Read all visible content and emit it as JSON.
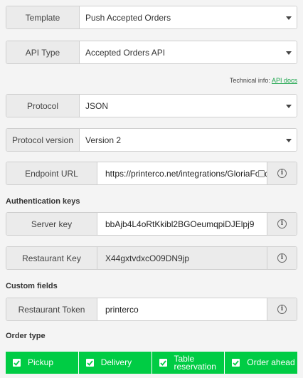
{
  "template": {
    "label": "Template",
    "value": "Push Accepted Orders"
  },
  "api_type": {
    "label": "API Type",
    "value": "Accepted Orders API"
  },
  "technical_info": {
    "prefix": "Technical info:",
    "link": "API docs"
  },
  "protocol": {
    "label": "Protocol",
    "value": "JSON"
  },
  "protocol_version": {
    "label": "Protocol version",
    "value": "Version 2"
  },
  "endpoint": {
    "label": "Endpoint URL",
    "value": "https://printerco.net/integrations/GloriaFood"
  },
  "auth_section": "Authentication keys",
  "server_key": {
    "label": "Server key",
    "value": "bbAjb4L4oRtKkibl2BGOeumqpiDJElpj9"
  },
  "restaurant_key": {
    "label": "Restaurant Key",
    "value": "X44gxtvdxcO09DN9jp"
  },
  "custom_section": "Custom fields",
  "restaurant_token": {
    "label": "Restaurant Token",
    "value": "printerco"
  },
  "order_section": "Order type",
  "order_types": [
    {
      "label": "Pickup",
      "checked": true
    },
    {
      "label": "Delivery",
      "checked": true
    },
    {
      "label": "Table reservation",
      "checked": true
    },
    {
      "label": "Order ahead",
      "checked": true
    }
  ],
  "accent_color": "#00cc44",
  "link_color": "#1aa44a"
}
